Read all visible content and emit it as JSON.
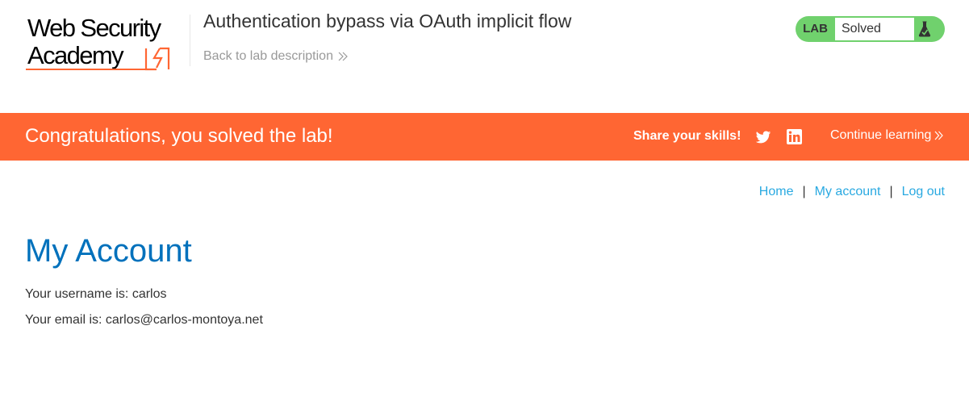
{
  "header": {
    "logo": {
      "line1": "Web Security",
      "line2": "Academy"
    },
    "lab_title": "Authentication bypass via OAuth implicit flow",
    "back_link": "Back to lab description"
  },
  "status": {
    "tag": "LAB",
    "value": "Solved",
    "icon": "flask-icon"
  },
  "banner": {
    "message": "Congratulations, you solved the lab!",
    "share_label": "Share your skills!",
    "social": [
      "twitter-icon",
      "linkedin-icon"
    ],
    "continue_label": "Continue learning"
  },
  "nav": {
    "home": "Home",
    "separator": "|",
    "my_account": "My account",
    "log_out": "Log out"
  },
  "account": {
    "title": "My Account",
    "username_label": "Your username is: ",
    "username": "carlos",
    "email_label": "Your email is: ",
    "email": "carlos@carlos-montoya.net"
  },
  "colors": {
    "brand_orange": "#ff6633",
    "solved_green": "#70d16d",
    "link_blue": "#29a9e1",
    "title_blue": "#0071bc"
  }
}
